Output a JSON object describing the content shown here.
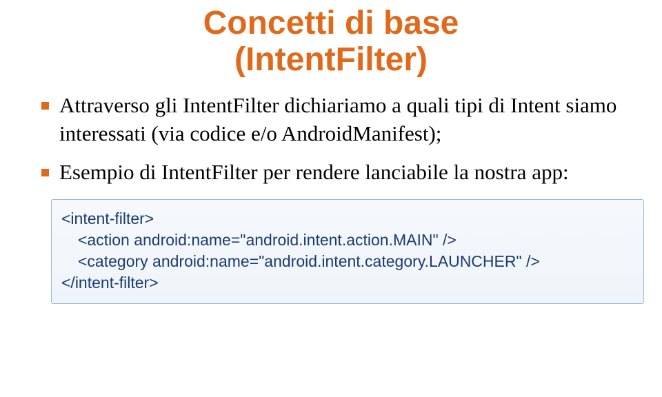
{
  "colors": {
    "accent": "#e06a1b",
    "code_text": "#1b3a6f",
    "code_border": "#9bb8d3"
  },
  "title": {
    "line1": "Concetti di base",
    "line2": "(IntentFilter)"
  },
  "bullets": [
    "Attraverso gli IntentFilter dichiariamo a quali tipi di Intent siamo interessati (via codice e/o AndroidManifest);",
    "Esempio di IntentFilter per rendere lanciabile la nostra app:"
  ],
  "code": {
    "open": "<intent-filter>",
    "action": "<action android:name=\"android.intent.action.MAIN\" />",
    "category": "<category android:name=\"android.intent.category.LAUNCHER\" />",
    "close": "</intent-filter>"
  }
}
